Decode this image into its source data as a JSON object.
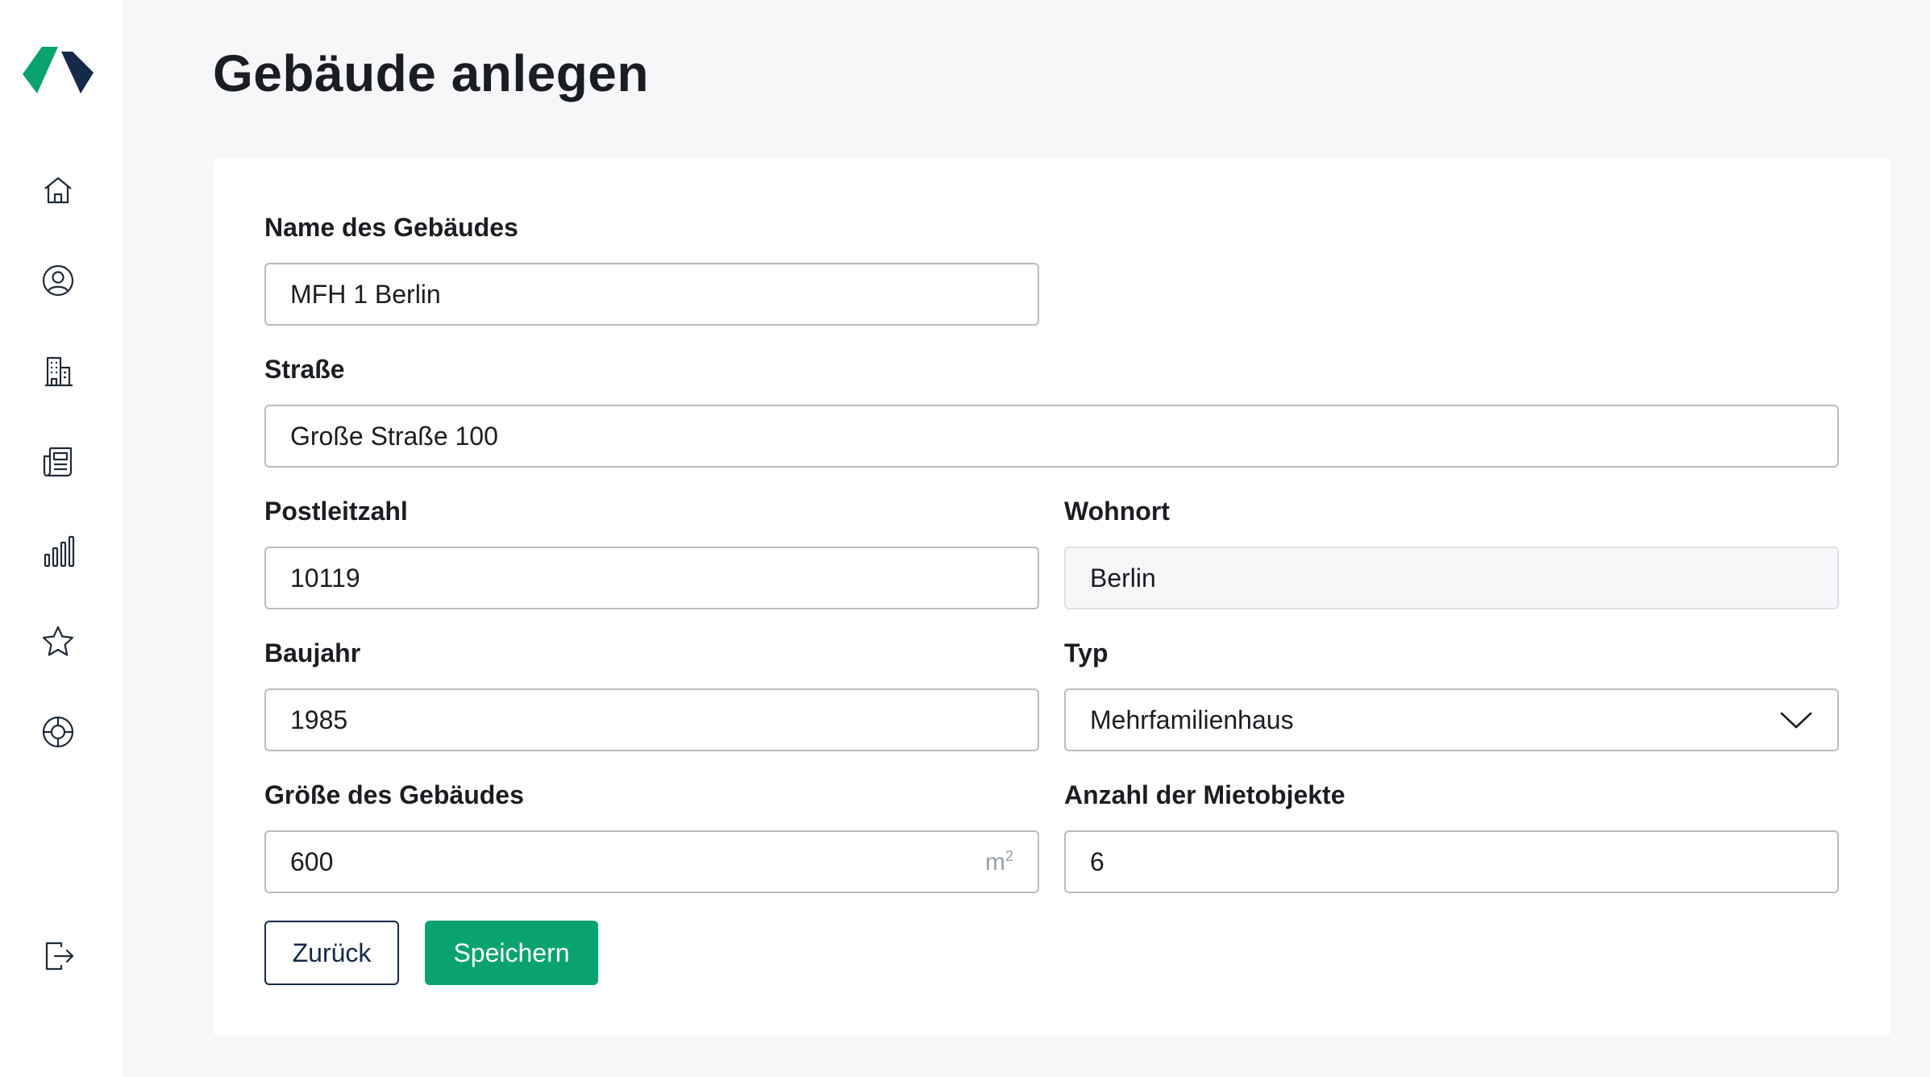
{
  "colors": {
    "brand_green": "#0aa36f",
    "brand_navy": "#15294a",
    "page_background": "#f6f7f9",
    "input_border": "#b7bcc3"
  },
  "sidebar": {
    "logo": "app-logo",
    "items": [
      {
        "id": "home",
        "icon": "home-icon"
      },
      {
        "id": "profile",
        "icon": "user-circle-icon"
      },
      {
        "id": "buildings",
        "icon": "building-icon"
      },
      {
        "id": "documents",
        "icon": "newspaper-icon"
      },
      {
        "id": "reports",
        "icon": "bar-chart-icon"
      },
      {
        "id": "favorites",
        "icon": "star-icon"
      },
      {
        "id": "help",
        "icon": "lifebuoy-icon"
      }
    ],
    "logout": {
      "icon": "logout-icon"
    }
  },
  "page": {
    "title": "Gebäude anlegen"
  },
  "form": {
    "name": {
      "label": "Name des Gebäudes",
      "value": "MFH 1 Berlin"
    },
    "street": {
      "label": "Straße",
      "value": "Große Straße 100"
    },
    "postal_code": {
      "label": "Postleitzahl",
      "value": "10119"
    },
    "city": {
      "label": "Wohnort",
      "value": "Berlin",
      "disabled": true
    },
    "year_built": {
      "label": "Baujahr",
      "value": "1985"
    },
    "type": {
      "label": "Typ",
      "value": "Mehrfamilienhaus"
    },
    "size": {
      "label": "Größe des Gebäudes",
      "value": "600",
      "unit": "m",
      "unit_sup": "2"
    },
    "units_count": {
      "label": "Anzahl der Mietobjekte",
      "value": "6"
    }
  },
  "actions": {
    "back_label": "Zurück",
    "save_label": "Speichern"
  }
}
